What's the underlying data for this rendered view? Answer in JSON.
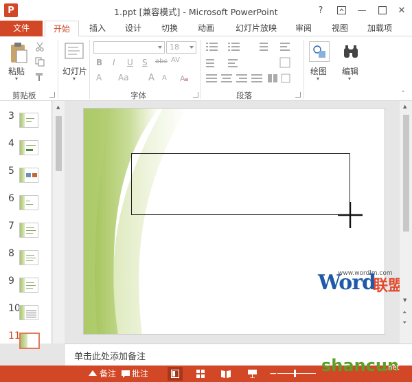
{
  "window": {
    "title": "1.ppt [兼容模式] - Microsoft PowerPoint",
    "help": "?",
    "minimize": "—",
    "close": "✕"
  },
  "quick_access": {
    "save_icon": "save-icon",
    "undo_icon": "undo-icon",
    "redo_icon": "redo-icon",
    "present_icon": "present-icon"
  },
  "tabs": [
    "文件",
    "开始",
    "插入",
    "设计",
    "切换",
    "动画",
    "幻灯片放映",
    "审阅",
    "视图",
    "加载项"
  ],
  "ribbon": {
    "clipboard": {
      "paste_label": "粘贴",
      "group_label": "剪贴板"
    },
    "slides": {
      "new_slide_label": "幻灯片"
    },
    "font": {
      "group_label": "字体",
      "font_size": "18",
      "bold": "B",
      "italic": "I",
      "underline": "U",
      "shadow": "S",
      "strike": "abc",
      "char_spacing": "AV",
      "font_color": "A",
      "change_case": "Aa",
      "grow": "A",
      "shrink": "A"
    },
    "paragraph": {
      "group_label": "段落"
    },
    "drawing": {
      "label": "绘图"
    },
    "editing": {
      "label": "编辑"
    }
  },
  "thumbnails": [
    {
      "num": "3"
    },
    {
      "num": "4"
    },
    {
      "num": "5"
    },
    {
      "num": "6"
    },
    {
      "num": "7"
    },
    {
      "num": "8"
    },
    {
      "num": "9"
    },
    {
      "num": "10"
    },
    {
      "num": "11"
    }
  ],
  "notes": {
    "placeholder": "单击此处添加备注"
  },
  "statusbar": {
    "notes_label": "备注",
    "comments_label": "批注"
  },
  "watermark": {
    "brand_word": "Word",
    "brand_cn": "联盟",
    "url": "www.wordlm.com",
    "site": "shancun",
    "site_suffix": ".net"
  },
  "colors": {
    "accent": "#d24726",
    "slide_green": "#a8c46a"
  }
}
